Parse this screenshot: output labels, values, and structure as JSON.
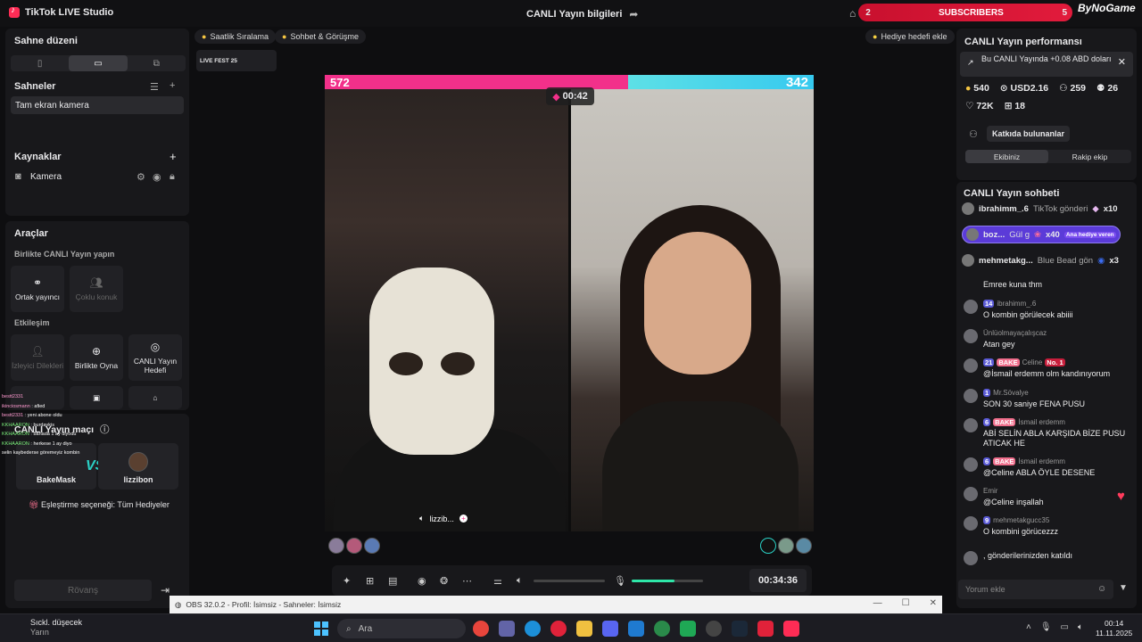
{
  "app": {
    "title": "TikTok LIVE Studio",
    "center_title": "CANLI Yayın bilgileri",
    "brand": "ByNoGame"
  },
  "subscribers": {
    "left": "2",
    "label": "SUBSCRIBERS",
    "right": "5"
  },
  "left": {
    "scene_layout": "Sahne düzeni",
    "scenes": "Sahneler",
    "scene_item": "Tam ekran kamera",
    "sources": "Kaynaklar",
    "source_item": "Kamera",
    "tools": "Araçlar",
    "collab_heading": "Birlikte CANLI Yayın yapın",
    "tool_partner": "Ortak yayıncı",
    "tool_multi": "Çoklu konuk",
    "interaction_heading": "Etkileşim",
    "tool_requests": "İzleyici Dilekleri",
    "tool_play": "Birlikte Oyna",
    "tool_goal": "CANLI Yayın Hedefi",
    "match": "CANLI Yayın maçı",
    "player_l": "BakeMask",
    "player_r": "lizzibon",
    "pairing": "Eşleştirme seçeneği: Tüm Hediyeler",
    "rematch": "Rövanş"
  },
  "mini_chat": [
    {
      "user": "bestt2331",
      "text": ""
    },
    {
      "user": "ikinciosmann",
      "text": "afied"
    },
    {
      "user": "bestt2331",
      "text": "yeni abone oldu"
    },
    {
      "user": "",
      "text": ""
    },
    {
      "user": "KKHAARON",
      "text": "burdaykis"
    },
    {
      "user": "KKHAARON",
      "text": "banada 1 ay diyodu"
    },
    {
      "user": "KKHAARON",
      "text": "herkese 1 ay diyo"
    },
    {
      "user": "",
      "text": "selin kaybederse göremeyiz kombin"
    }
  ],
  "chips": {
    "hourly": "Saatlik Sıralama",
    "chat": "Sohbet & Görüşme",
    "gift_goal": "Hediye hedefi ekle",
    "event": "LIVE FEST 25"
  },
  "battle": {
    "score_left": "572",
    "score_right": "342",
    "timer": "00:42",
    "guest_name": "lizzib..."
  },
  "controls": {
    "elapsed": "00:34:36",
    "volume": 0.0,
    "mic": 0.6
  },
  "obs": {
    "title": "OBS 32.0.2 - Profil: İsimsiz - Sahneler: İsimsiz"
  },
  "right": {
    "perf_title": "CANLI Yayın performansı",
    "notice": "Bu CANLI Yayında +0.08 ABD doları",
    "stats": {
      "a": "540",
      "b": "USD2.16",
      "c": "259",
      "d": "26",
      "e": "72K",
      "f": "18"
    },
    "contributors": "Katkıda bulunanlar",
    "tab_team": "Ekibiniz",
    "tab_rival": "Rakip ekip",
    "chat_title": "CANLI Yayın sohbeti",
    "gifts": [
      {
        "user": "ibrahimm_.6",
        "text": "TikTok gönderi",
        "count": "x10"
      },
      {
        "user": "boz...",
        "text": "Gül g",
        "count": "x40",
        "tag": "Ana hediye veren"
      },
      {
        "user": "mehmetakg...",
        "text": "Blue Bead gön",
        "count": "x3"
      }
    ],
    "messages": [
      {
        "level": "",
        "name": "",
        "text": "Emree kuna thm"
      },
      {
        "level": "14",
        "name": "ibrahimm_.6",
        "text": "O kombin görülecek abiiii"
      },
      {
        "level": "",
        "name": "Ünlüolmayaçalışcaz",
        "text": "Atan gey"
      },
      {
        "level": "21",
        "badge": "BAKE",
        "name": "Celine",
        "rank": "No. 1",
        "text": "@İsmail erdemm olm kandınıyorum"
      },
      {
        "level": "1",
        "name": "Mr.Sövalye",
        "text": "SON 30 saniye FENA PUSU"
      },
      {
        "level": "6",
        "badge": "BAKE",
        "name": "İsmail erdemm",
        "text": "ABİ SELİN ABLA KARŞIDA BİZE PUSU ATICAK HE"
      },
      {
        "level": "6",
        "badge": "BAKE",
        "name": "İsmail erdemm",
        "text": "@Celine ABLA ÖYLE DESENE"
      },
      {
        "level": "",
        "name": "Emir",
        "text": "@Celine inşallah"
      },
      {
        "level": "9",
        "name": "mehmetakgucc35",
        "text": "O kombini görücezzz"
      },
      {
        "level": "",
        "name": "",
        "text": ", gönderilerinizden katıldı"
      }
    ],
    "comment_placeholder": "Yorum ekle"
  },
  "taskbar": {
    "weather_title": "Sıckl. düşecek",
    "weather_sub": "Yarın",
    "search": "Ara",
    "time": "00:14",
    "date": "11.11.2025"
  }
}
